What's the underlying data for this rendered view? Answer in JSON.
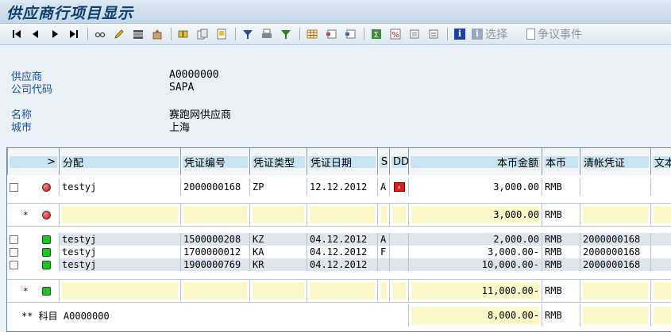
{
  "title": "供应商行项目显示",
  "toolbar": {
    "select_label": "选择",
    "dispute_label": "争议事件"
  },
  "header": {
    "vendor_label": "供应商",
    "vendor_value": "A0000000",
    "company_label": "公司代码",
    "company_value": "SAPA",
    "name_label": "名称",
    "name_value": "赛跑网供应商",
    "city_label": "城市",
    "city_value": "上海"
  },
  "columns": {
    "sel": ">",
    "assign": "分配",
    "doc_no": "凭证编号",
    "doc_type": "凭证类型",
    "doc_date": "凭证日期",
    "s": "S",
    "dd": "DD",
    "amount": "本币金额",
    "currency": "本币",
    "clearing": "清帐凭证",
    "text": "文本"
  },
  "rows": [
    {
      "assign": "testyj",
      "doc_no": "2000000168",
      "doc_type": "ZP",
      "doc_date": "12.12.2012",
      "s": "A",
      "dd": "dd-icon",
      "amount": "3,000.00",
      "currency": "RMB",
      "clearing": "",
      "status": "red"
    },
    {
      "assign": "testyj",
      "doc_no": "1500000208",
      "doc_type": "KZ",
      "doc_date": "04.12.2012",
      "s": "A",
      "dd": "",
      "amount": "2,000.00",
      "currency": "RMB",
      "clearing": "2000000168",
      "status": "green"
    },
    {
      "assign": "testyj",
      "doc_no": "1700000012",
      "doc_type": "KA",
      "doc_date": "04.12.2012",
      "s": "F",
      "dd": "",
      "amount": "3,000.00-",
      "currency": "RMB",
      "clearing": "2000000168",
      "status": "green"
    },
    {
      "assign": "testyj",
      "doc_no": "1900000769",
      "doc_type": "KR",
      "doc_date": "04.12.2012",
      "s": "",
      "dd": "",
      "amount": "10,000.00-",
      "currency": "RMB",
      "clearing": "2000000168",
      "status": "green"
    }
  ],
  "subtotals": {
    "open_star": "*",
    "open_amount": "3,000.00",
    "open_currency": "RMB",
    "cleared_star": "*",
    "cleared_amount": "11,000.00-",
    "cleared_currency": "RMB",
    "total_label": "** 科目 A0000000",
    "total_amount": "8,000.00-",
    "total_currency": "RMB"
  }
}
